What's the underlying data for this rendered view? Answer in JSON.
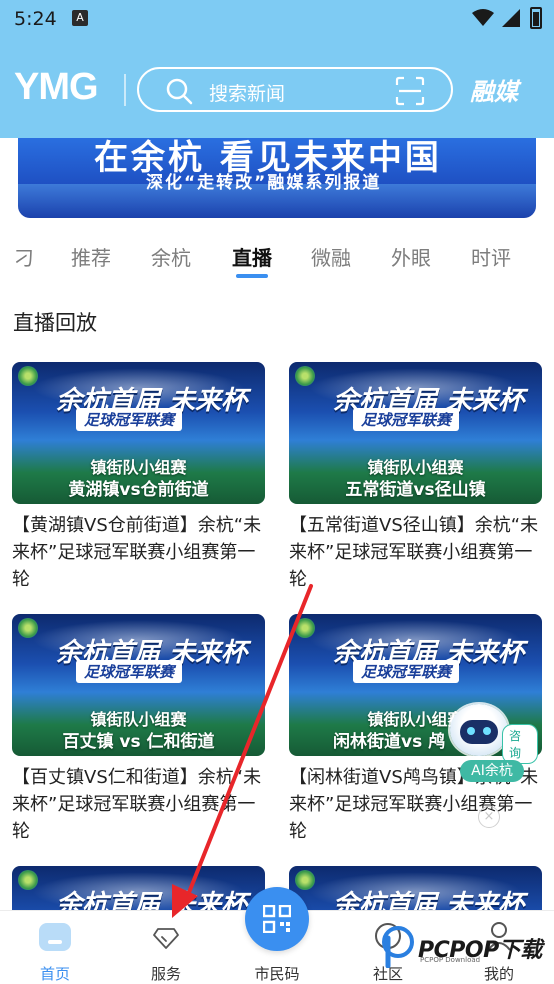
{
  "status_bar": {
    "time": "5:24",
    "notification_icon": "A"
  },
  "header": {
    "logo": "YMG",
    "search_placeholder": "搜索新闻",
    "brand_right": "融媒"
  },
  "banner": {
    "line1": "在余杭 看见未来中国",
    "line2": "深化“走转改”融媒系列报道"
  },
  "tabs": {
    "items": [
      {
        "label": "刁"
      },
      {
        "label": "推荐"
      },
      {
        "label": "余杭"
      },
      {
        "label": "直播"
      },
      {
        "label": "微融"
      },
      {
        "label": "外眼"
      },
      {
        "label": "时评"
      }
    ],
    "active": "直播"
  },
  "section_title": "直播回放",
  "thumb_common": {
    "title": "余杭首届 未来杯",
    "subtitle": "足球冠军联赛",
    "round": "镇街队小组赛"
  },
  "cards": [
    {
      "match": "黄湖镇vs仓前街道",
      "caption": "【黄湖镇VS仓前街道】余杭“未来杯”足球冠军联赛小组赛第一轮"
    },
    {
      "match": "五常街道vs径山镇",
      "caption": "【五常街道VS径山镇】余杭“未来杯”足球冠军联赛小组赛第一轮"
    },
    {
      "match": "百丈镇 vs 仁和街道",
      "caption": "【百丈镇VS仁和街道】余杭“未来杯”足球冠军联赛小组赛第一轮"
    },
    {
      "match": "闲林街道vs 鸬",
      "caption": "【闲林街道VS鸬鸟镇】余杭“未来杯”足球冠军联赛小组赛第一轮"
    }
  ],
  "ai_widget": {
    "consult": "咨询",
    "label": "AI余杭",
    "close": "×"
  },
  "bottom_nav": {
    "items": [
      {
        "label": "首页",
        "icon": "home-icon"
      },
      {
        "label": "服务",
        "icon": "diamond-icon"
      },
      {
        "label": "市民码",
        "icon": "qr-code-icon"
      },
      {
        "label": "社区",
        "icon": "community-icon"
      },
      {
        "label": "我的",
        "icon": "user-icon"
      }
    ],
    "active": "首页"
  },
  "watermark": {
    "brand": "PCPOP下载",
    "sub": "PCPOP Download"
  },
  "colors": {
    "header_bg": "#7ecbf3",
    "accent": "#3a8ff0",
    "annotation_arrow": "#e8262a"
  }
}
